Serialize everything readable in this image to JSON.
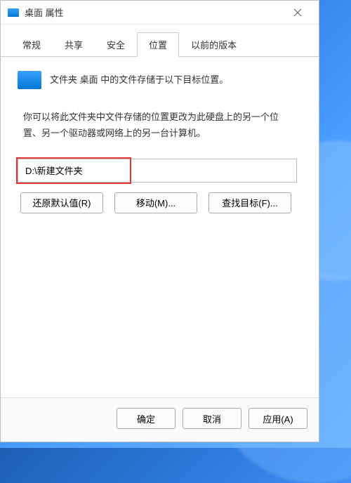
{
  "titlebar": {
    "title": "桌面 属性"
  },
  "tabs": {
    "items": [
      "常规",
      "共享",
      "安全",
      "位置",
      "以前的版本"
    ],
    "active_index": 3
  },
  "content": {
    "header_text": "文件夹 桌面 中的文件存储于以下目标位置。",
    "description": "你可以将此文件夹中文件存储的位置更改为此硬盘上的另一个位置、另一个驱动器或网络上的另一台计算机。",
    "path_value": "D:\\新建文件夹",
    "buttons": {
      "restore": "还原默认值(R)",
      "move": "移动(M)...",
      "find": "查找目标(F)..."
    }
  },
  "footer": {
    "ok": "确定",
    "cancel": "取消",
    "apply": "应用(A)"
  }
}
